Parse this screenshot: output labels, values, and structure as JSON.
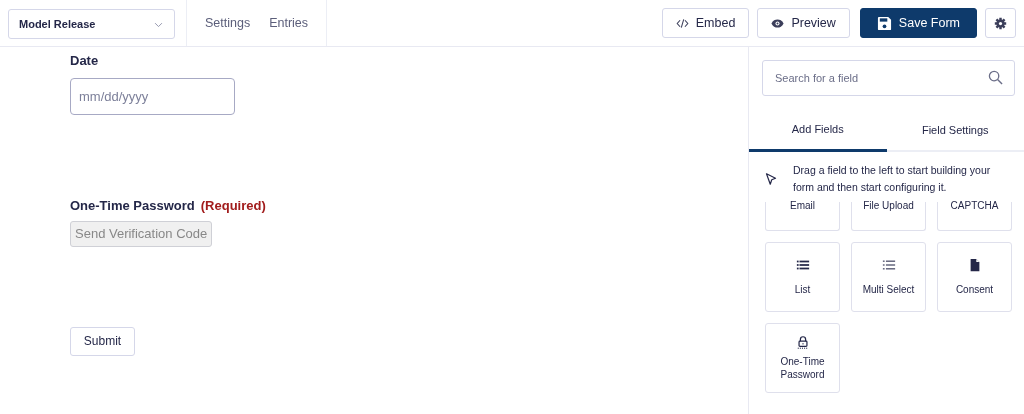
{
  "header": {
    "form_select": "Model Release",
    "nav": [
      {
        "label": "Settings"
      },
      {
        "label": "Entries"
      }
    ],
    "buttons": [
      {
        "kind": "embed",
        "label": "Embed",
        "primary": false
      },
      {
        "kind": "preview",
        "label": "Preview",
        "primary": false
      },
      {
        "kind": "save",
        "label": "Save Form",
        "primary": true
      },
      {
        "kind": "settings",
        "primary": false
      }
    ]
  },
  "form": {
    "fields": [
      {
        "kind": "date",
        "label": "Date",
        "placeholder": "mm/dd/yyyy"
      },
      {
        "kind": "otp",
        "label": "One-Time Password",
        "required": "(Required)",
        "button": "Send Verification Code",
        "disabled": true
      }
    ],
    "submit": "Submit"
  },
  "sidebar": {
    "search": {
      "placeholder": "Search for a field"
    },
    "tabs": [
      {
        "label": "Add Fields",
        "selected": true
      },
      {
        "label": "Field Settings",
        "selected": false
      }
    ],
    "hint": "Drag a field to the left to start building your form and then start configuring it.",
    "tiles": [
      {
        "kind": "cut",
        "label": "Email"
      },
      {
        "kind": "cut",
        "label": "File Upload"
      },
      {
        "kind": "cut",
        "label": "CAPTCHA"
      },
      {
        "kind": "list",
        "label": "List"
      },
      {
        "kind": "multi",
        "label": "Multi Select"
      },
      {
        "kind": "doc",
        "label": "Consent"
      },
      {
        "kind": "lock",
        "label": "One-Time Password"
      }
    ]
  }
}
